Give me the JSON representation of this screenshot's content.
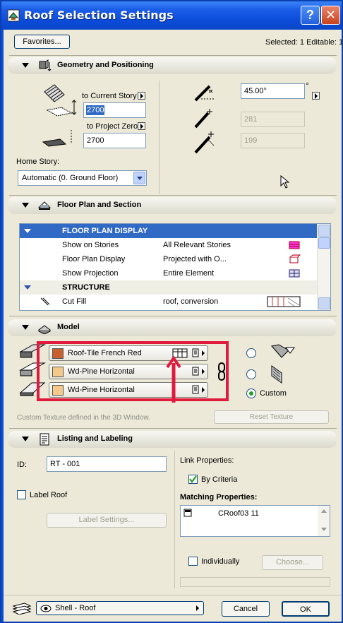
{
  "window": {
    "title": "Roof Selection Settings",
    "help": "?",
    "close": "✕"
  },
  "top": {
    "favorites": "Favorites...",
    "selected": "Selected: 1 Editable: 1"
  },
  "geometry": {
    "title": "Geometry and Positioning",
    "to_current_story": "to Current Story",
    "current_value": "2700",
    "to_project_zero": "to Project Zero",
    "zero_value": "2700",
    "home_story_label": "Home Story:",
    "home_story_value": "Automatic (0. Ground Floor)",
    "angle_value": "45.00°",
    "degree_mark": "°",
    "value2": "281",
    "value3": "199"
  },
  "floorplan": {
    "title": "Floor Plan and Section",
    "rows": [
      {
        "c1": "FLOOR PLAN DISPLAY",
        "c2": ""
      },
      {
        "c1": "Show on Stories",
        "c2": "All Relevant Stories"
      },
      {
        "c1": "Floor Plan Display",
        "c2": "Projected with O..."
      },
      {
        "c1": "Show Projection",
        "c2": "Entire Element"
      },
      {
        "c1": "STRUCTURE",
        "c2": ""
      },
      {
        "c1": "Cut Fill",
        "c2": "roof, conversion"
      }
    ]
  },
  "model": {
    "title": "Model",
    "surfaces": [
      {
        "name": "Roof-Tile French Red",
        "color": "#c8612c"
      },
      {
        "name": "Wd-Pine Horizontal",
        "color": "#f4c98a"
      },
      {
        "name": "Wd-Pine Horizontal",
        "color": "#f4c98a"
      }
    ],
    "custom_label": "Custom",
    "texture_note": "Custom Texture defined in the 3D Window.",
    "reset_texture": "Reset Texture"
  },
  "listing": {
    "title": "Listing and Labeling",
    "id_label": "ID:",
    "id_value": "RT - 001",
    "label_roof": "Label Roof",
    "label_settings": "Label Settings...",
    "link_properties": "Link Properties:",
    "by_criteria": "By Criteria",
    "matching_properties": "Matching Properties:",
    "property_item": "CRoof03 11",
    "individually": "Individually",
    "choose": "Choose..."
  },
  "bottom": {
    "layer": "Shell - Roof",
    "cancel": "Cancel",
    "ok": "OK"
  },
  "colors": {
    "title_blue": "#0b4bd8",
    "selection": "#316ac5",
    "annotation_red": "#e01a3c"
  }
}
